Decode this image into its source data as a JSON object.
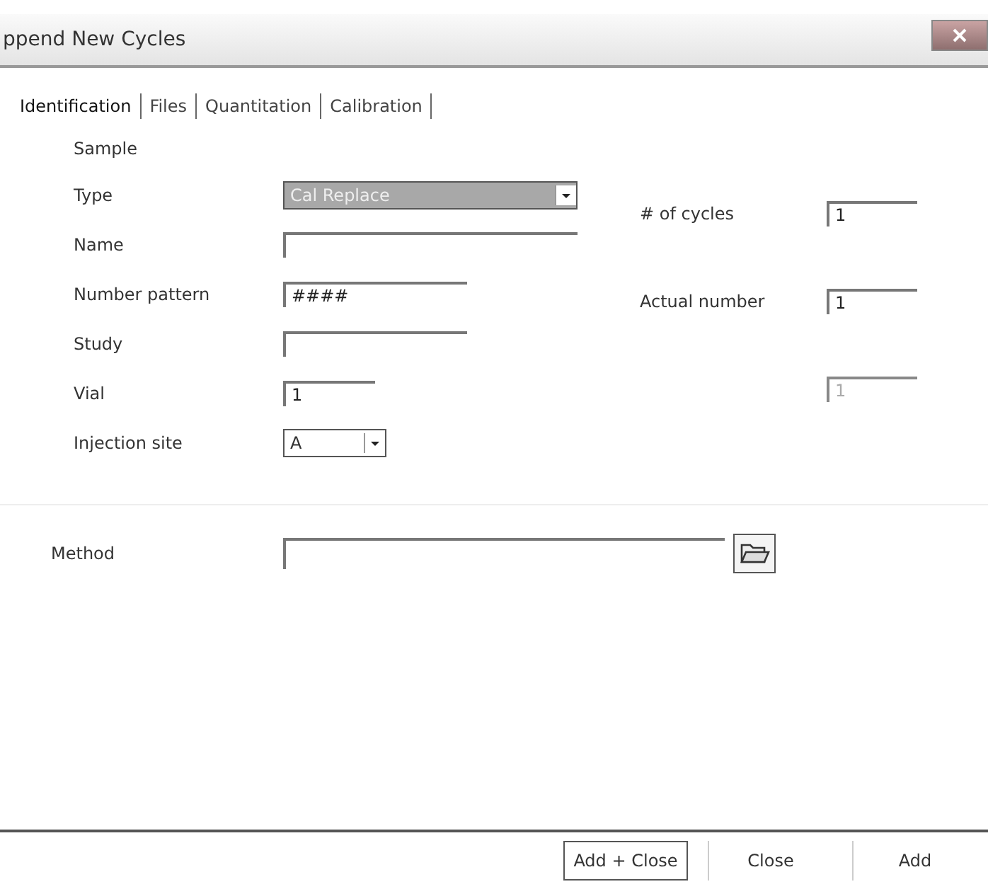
{
  "window": {
    "title": "ppend New Cycles"
  },
  "tabs": [
    {
      "label": "Identification",
      "selected": true
    },
    {
      "label": "Files",
      "selected": false
    },
    {
      "label": "Quantitation",
      "selected": false
    },
    {
      "label": "Calibration",
      "selected": false
    }
  ],
  "sample": {
    "heading": "Sample",
    "fields": [
      {
        "label": "Type",
        "kind": "dropdown",
        "value": "Cal Replace",
        "highlighted": true
      },
      {
        "label": "Name",
        "kind": "text"
      },
      {
        "label": "Number pattern",
        "kind": "text",
        "value": "####"
      },
      {
        "label": "Study",
        "kind": "text"
      },
      {
        "label": "Vial",
        "kind": "text",
        "value": "1"
      },
      {
        "label": "Injection site",
        "kind": "dropdown",
        "value": "A",
        "highlighted": false
      }
    ]
  },
  "counts": [
    {
      "label": "# of cycles",
      "value": "1",
      "disabled": false
    },
    {
      "label": "Actual number",
      "value": "1",
      "disabled": false
    },
    {
      "value": "1",
      "disabled": true
    }
  ],
  "method": {
    "label": "Method"
  },
  "buttons": [
    {
      "label": "Add + Close",
      "default": true
    },
    {
      "label": "Close",
      "default": false
    },
    {
      "label": "Add",
      "default": false
    }
  ]
}
